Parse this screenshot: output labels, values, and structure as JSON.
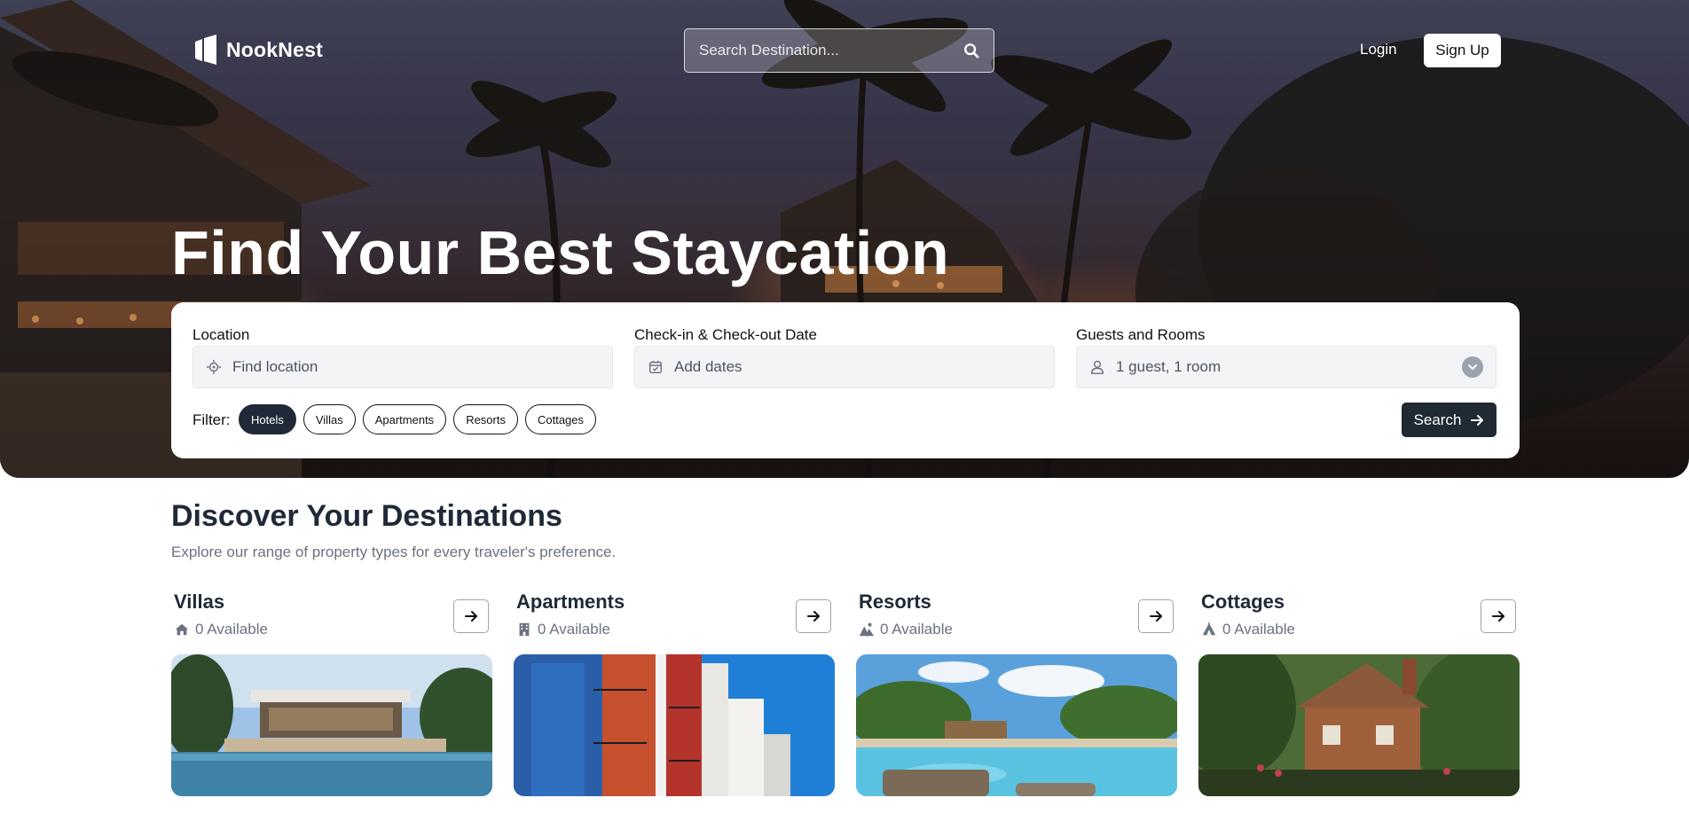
{
  "brand": {
    "name": "NookNest"
  },
  "nav": {
    "search_placeholder": "Search Destination...",
    "login_label": "Login",
    "signup_label": "Sign Up"
  },
  "hero": {
    "title": "Find Your Best Staycation"
  },
  "search_form": {
    "location": {
      "label": "Location",
      "placeholder": "Find location",
      "icon": "location-target-icon"
    },
    "dates": {
      "label": "Check-in & Check-out Date",
      "placeholder": "Add dates",
      "icon": "calendar-icon"
    },
    "guests": {
      "label": "Guests and Rooms",
      "value": "1 guest, 1 room",
      "icon": "user-icon"
    },
    "filter_label": "Filter:",
    "filters": [
      {
        "label": "Hotels",
        "active": true
      },
      {
        "label": "Villas",
        "active": false
      },
      {
        "label": "Apartments",
        "active": false
      },
      {
        "label": "Resorts",
        "active": false
      },
      {
        "label": "Cottages",
        "active": false
      }
    ],
    "search_button": "Search"
  },
  "discover": {
    "title": "Discover Your Destinations",
    "subtitle": "Explore our range of property types for every traveler's preference.",
    "categories": [
      {
        "name": "Villas",
        "available": "0 Available",
        "icon": "house-icon"
      },
      {
        "name": "Apartments",
        "available": "0 Available",
        "icon": "building-icon"
      },
      {
        "name": "Resorts",
        "available": "0 Available",
        "icon": "resort-icon"
      },
      {
        "name": "Cottages",
        "available": "0 Available",
        "icon": "cabin-icon"
      }
    ]
  },
  "colors": {
    "primary_dark": "#1f2a33",
    "text": "#1f2937",
    "muted": "#6b7280"
  }
}
